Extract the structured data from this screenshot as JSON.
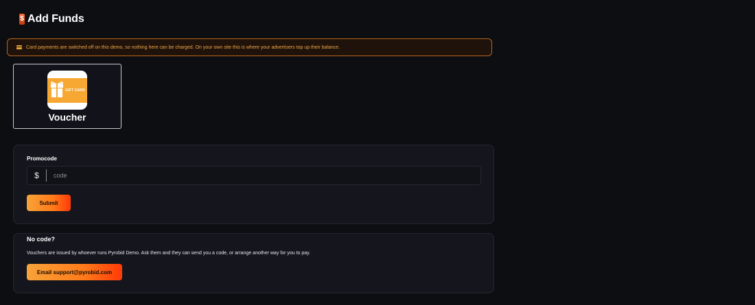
{
  "header": {
    "icon": "dollar-banknote-icon",
    "icon_glyph": "$",
    "title": "Add Funds"
  },
  "notice": {
    "icon": "credit-card-icon",
    "text": "Card payments are switched off on this demo, so nothing here can be charged. On your own site this is where your advertisers top up their balance.",
    "border_color": "#b8661e",
    "text_color": "#f0a64a"
  },
  "payment_method": {
    "icon": "gift-card-icon",
    "icon_text": "GIFT CARD",
    "label": "Voucher"
  },
  "promocode": {
    "label": "Promocode",
    "addon": "$",
    "value": "",
    "placeholder": "code",
    "submit_label": "Submit"
  },
  "no_code": {
    "title": "No code?",
    "text": "Vouchers are issued by whoever runs Pyrobid Demo. Ask them and they can send you a code, or arrange another way for you to pay.",
    "email_label": "Email support@pyrobid.com"
  },
  "colors": {
    "background": "#0d0e12",
    "panel": "#15161d",
    "accent_start": "#f7a33a",
    "accent_end": "#ff3a08",
    "voucher_orange": "#f6a832"
  }
}
